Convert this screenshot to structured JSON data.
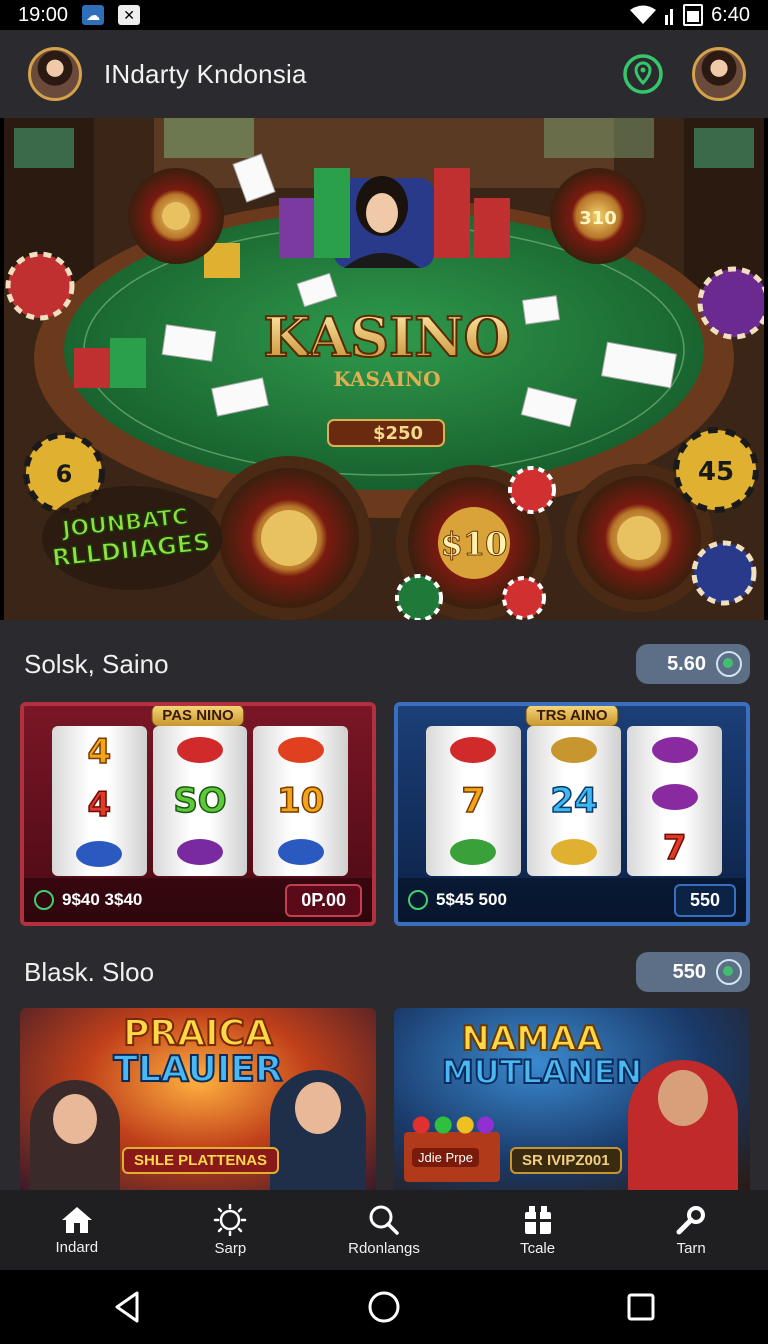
{
  "status_bar": {
    "time": "19:00",
    "battery_time": "6:40"
  },
  "app_bar": {
    "title": "INdarty Kndonsia"
  },
  "hero": {
    "main_title": "KASINO",
    "sub_title": "KASAINO",
    "table_plate": "$250",
    "left_badge_line1": "JOUNBATC",
    "left_badge_line2": "RLLDIIAGES",
    "left_roulette_label": "310",
    "right_roulette_label": "$10",
    "center_wheel_label": "$10",
    "chip_right_label": "45",
    "chip_left_label": "6"
  },
  "section1": {
    "title": "Solsk, Saino",
    "pill_value": "5.60",
    "cards": [
      {
        "badge": "PAS NINO",
        "reels": [
          [
            "4",
            "4",
            ""
          ],
          [
            "",
            "SO",
            ""
          ],
          [
            "",
            "10",
            ""
          ]
        ],
        "foot_text": "9$40 3$40",
        "button": "0P.00",
        "theme": "red"
      },
      {
        "badge": "TRS AINO",
        "reels": [
          [
            "",
            "7",
            ""
          ],
          [
            "",
            "24",
            ""
          ],
          [
            "",
            "",
            "7"
          ]
        ],
        "foot_text": "5$45 500",
        "button": "550",
        "theme": "blue"
      }
    ]
  },
  "section2": {
    "title": "Blask. Sloo",
    "pill_value": "550",
    "cards": [
      {
        "title_line1": "PRAICA",
        "title_line2": "TLAUIER",
        "sub": "SHLE PLATTENAS"
      },
      {
        "title_line1": "NAMAA",
        "title_line2": "MUTLANEN",
        "sub": "SR IVIPZ001",
        "sub_left": "Jdie Prpe"
      }
    ]
  },
  "bottom_nav": [
    {
      "label": "Indard",
      "icon": "home-icon"
    },
    {
      "label": "Sarp",
      "icon": "sun-icon"
    },
    {
      "label": "Rdonlangs",
      "icon": "search-icon"
    },
    {
      "label": "Tcale",
      "icon": "gift-icon"
    },
    {
      "label": "Tarn",
      "icon": "wrench-icon"
    }
  ],
  "colors": {
    "app_bg": "#2b2b2f",
    "pill_bg": "#5d6f86",
    "accent_green": "#3fd06f",
    "felt": "#1f7a3a"
  }
}
